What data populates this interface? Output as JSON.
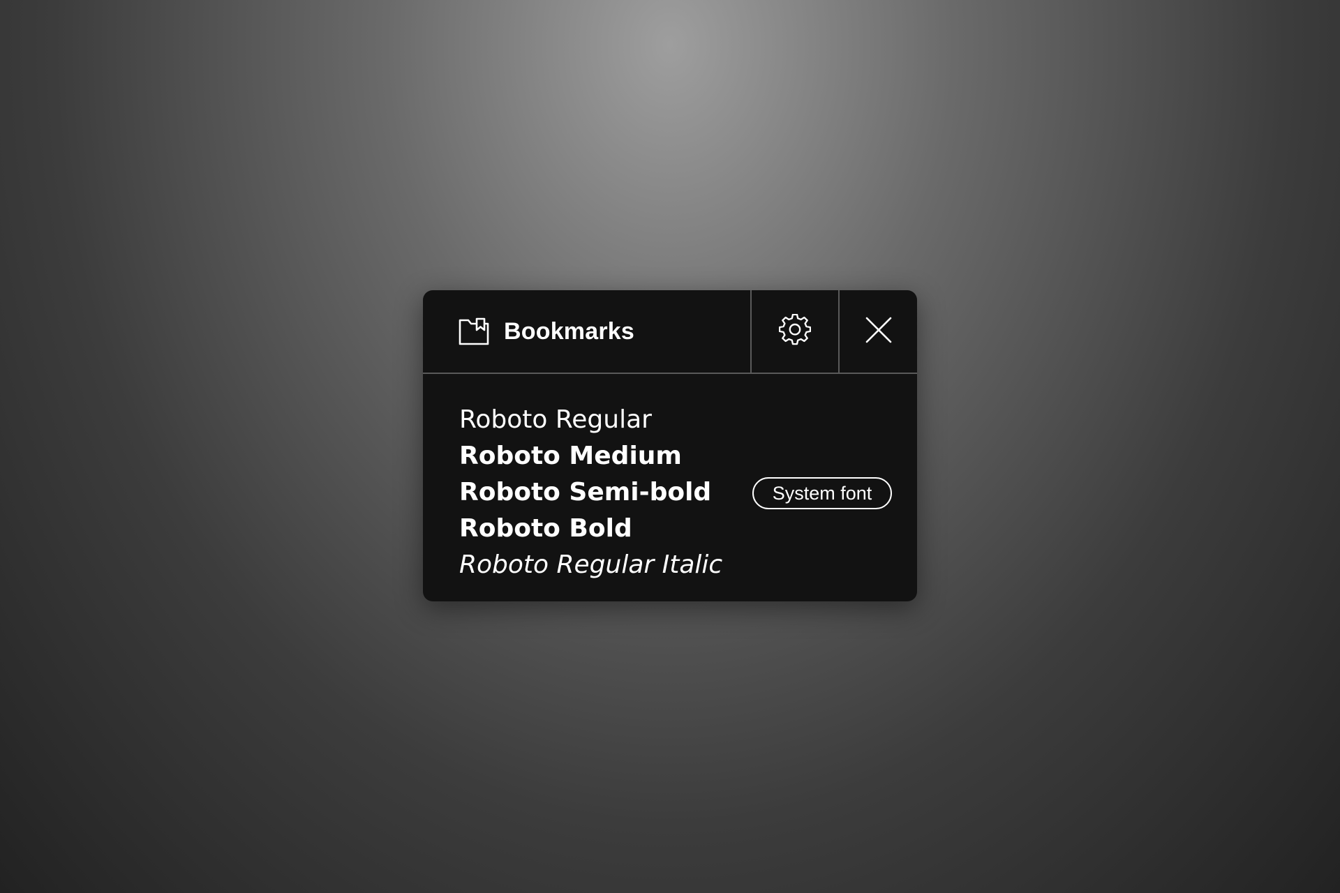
{
  "panel": {
    "title": "Bookmarks",
    "icons": {
      "title_icon": "bookmark-folder-icon",
      "settings_icon": "gear-icon",
      "close_icon": "close-icon"
    }
  },
  "fonts": {
    "items": [
      {
        "label": "Roboto Regular",
        "style": "regular"
      },
      {
        "label": "Roboto Medium",
        "style": "medium"
      },
      {
        "label": "Roboto Semi-bold",
        "style": "semi-bold"
      },
      {
        "label": "Roboto Bold",
        "style": "bold"
      },
      {
        "label": "Roboto Regular Italic",
        "style": "regular-italic"
      }
    ]
  },
  "badge": {
    "label": "System font"
  },
  "colors": {
    "panel_background": "#121212",
    "divider": "#5a5a5a",
    "text": "#ffffff"
  }
}
